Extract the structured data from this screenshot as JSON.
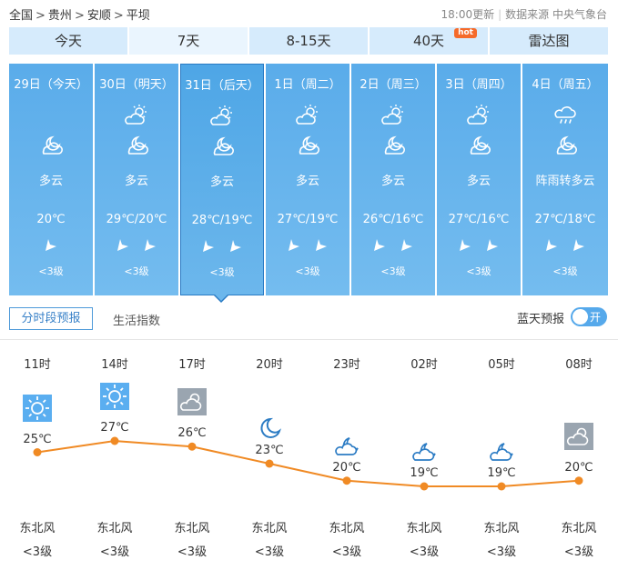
{
  "breadcrumb": [
    "全国",
    "贵州",
    "安顺",
    "平坝"
  ],
  "breadcrumb_sep": ">",
  "update_time": "18:00更新",
  "source": "数据来源 中央气象台",
  "tabs": [
    {
      "label": "今天"
    },
    {
      "label": "7天"
    },
    {
      "label": "8-15天"
    },
    {
      "label": "40天"
    },
    {
      "label": "雷达图"
    }
  ],
  "hot_badge": "hot",
  "days": [
    {
      "date": "29日（今天）",
      "weather": "多云",
      "temp": "20℃",
      "wind_level": "<3级",
      "icons": [
        "partly-cloudy-night-icon"
      ]
    },
    {
      "date": "30日（明天）",
      "weather": "多云",
      "temp": "29℃/20℃",
      "wind_level": "<3级",
      "icons": [
        "partly-cloudy-day-icon",
        "partly-cloudy-night-icon"
      ]
    },
    {
      "date": "31日（后天）",
      "weather": "多云",
      "temp": "28℃/19℃",
      "wind_level": "<3级",
      "icons": [
        "partly-cloudy-day-icon",
        "partly-cloudy-night-icon"
      ]
    },
    {
      "date": "1日（周二）",
      "weather": "多云",
      "temp": "27℃/19℃",
      "wind_level": "<3级",
      "icons": [
        "partly-cloudy-day-icon",
        "partly-cloudy-night-icon"
      ]
    },
    {
      "date": "2日（周三）",
      "weather": "多云",
      "temp": "26℃/16℃",
      "wind_level": "<3级",
      "icons": [
        "partly-cloudy-day-icon",
        "partly-cloudy-night-icon"
      ]
    },
    {
      "date": "3日（周四）",
      "weather": "多云",
      "temp": "27℃/16℃",
      "wind_level": "<3级",
      "icons": [
        "partly-cloudy-day-icon",
        "partly-cloudy-night-icon"
      ]
    },
    {
      "date": "4日（周五）",
      "weather": "阵雨转多云",
      "temp": "27℃/18℃",
      "wind_level": "<3级",
      "icons": [
        "shower-icon",
        "partly-cloudy-night-icon"
      ]
    }
  ],
  "subtabs": {
    "hourly": "分时段预报",
    "life": "生活指数"
  },
  "blue_sky": {
    "label": "蓝天预报",
    "toggle": "开"
  },
  "hourly": {
    "times": [
      "11时",
      "14时",
      "17时",
      "20时",
      "23时",
      "02时",
      "05时",
      "08时"
    ],
    "temps": [
      25,
      27,
      26,
      23,
      20,
      19,
      19,
      20
    ],
    "temp_labels": [
      "25℃",
      "27℃",
      "26℃",
      "23℃",
      "20℃",
      "19℃",
      "19℃",
      "20℃"
    ],
    "icons": [
      "sunny-icon",
      "sunny-icon",
      "cloudy-day-icon",
      "moon-icon",
      "cloud-night-icon",
      "cloud-night-icon",
      "cloud-night-icon",
      "cloudy-day-icon"
    ],
    "wind_dir": [
      "东北风",
      "东北风",
      "东北风",
      "东北风",
      "东北风",
      "东北风",
      "东北风",
      "东北风"
    ],
    "wind_level": [
      "<3级",
      "<3级",
      "<3级",
      "<3级",
      "<3级",
      "<3级",
      "<3级",
      "<3级"
    ]
  },
  "colors": {
    "card": "#5cafe9",
    "line": "#f08a24",
    "accent": "#3a82c8"
  }
}
